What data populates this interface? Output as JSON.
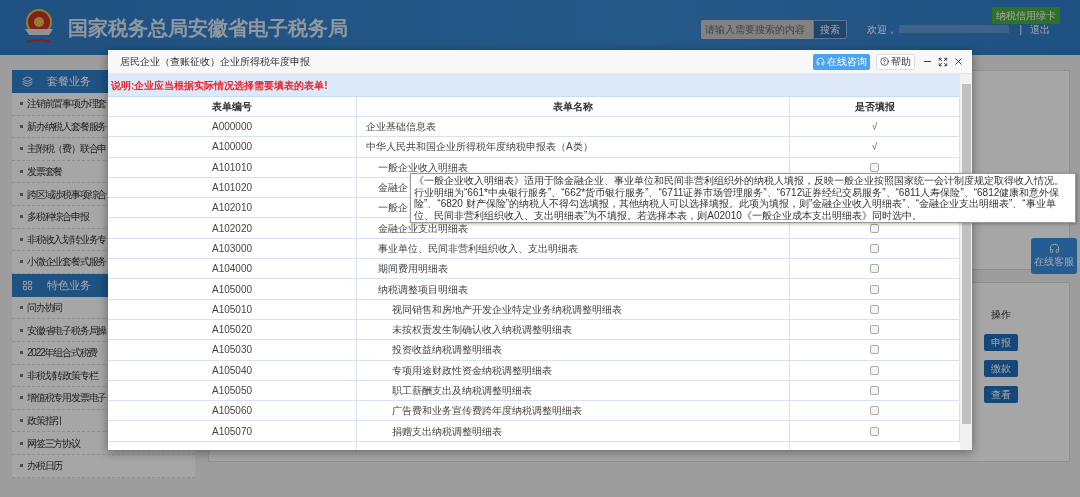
{
  "header": {
    "title": "国家税务总局安徽省电子税务局",
    "search": {
      "placeholder": "请输入需要搜索的内容",
      "button": "搜索"
    },
    "welcome": "欢迎，",
    "separator": "|",
    "logout": "退出",
    "badge": "纳税信用绿卡"
  },
  "sidebar": [
    {
      "title": "套餐业务",
      "items": [
        "注销前置事项办理套",
        "新办纳税人套餐服务",
        "主附税（费）联合申",
        "发票套餐",
        "跨区域涉税事项综合",
        "多税种综合申报",
        "非税收入划转业务专",
        "小微企业套餐式服务"
      ]
    },
    {
      "title": "特色业务",
      "items": [
        "问办协同",
        "安徽省电子税务局操",
        "2022年组合式税费",
        "非税划转政策专栏",
        "增值税专用发票电子",
        "政策指引",
        "网签三方协议",
        "办税日历"
      ]
    }
  ],
  "operations": {
    "column": "操作",
    "buttons": [
      "申报",
      "缴款",
      "查看"
    ]
  },
  "support_button": "在线客服",
  "modal": {
    "title": "居民企业（查账征收）企业所得税年度申报",
    "consult_button": "在线咨询",
    "help_button": "帮助",
    "notice": "说明:企业应当根据实际情况选择需要填表的表单!",
    "columns": [
      "表单编号",
      "表单名称",
      "是否填报"
    ],
    "rows": [
      {
        "code": "A000000",
        "name": "企业基础信息表",
        "fill": {
          "kind": "mark",
          "text": "√"
        }
      },
      {
        "code": "A100000",
        "name": "中华人民共和国企业所得税年度纳税申报表（A类）",
        "fill": {
          "kind": "mark",
          "text": "√"
        },
        "children": [
          {
            "code": "A101010",
            "name": "一般企业收入明细表",
            "fill": {
              "kind": "checkbox",
              "checked": false
            }
          },
          {
            "code": "A101020",
            "name": "金融企"
          },
          {
            "code": "A102010",
            "name": "一般企"
          },
          {
            "code": "A102020",
            "name": "金融企业支出明细表",
            "fill": {
              "kind": "checkbox",
              "checked": false
            }
          },
          {
            "code": "A103000",
            "name": "事业单位、民间非营利组织收入、支出明细表",
            "fill": {
              "kind": "checkbox",
              "checked": false
            }
          },
          {
            "code": "A104000",
            "name": "期间费用明细表",
            "fill": {
              "kind": "checkbox",
              "checked": false
            }
          },
          {
            "code": "A105000",
            "name": "纳税调整项目明细表",
            "fill": {
              "kind": "checkbox",
              "checked": false
            },
            "children": [
              {
                "code": "A105010",
                "name": "视同销售和房地产开发企业特定业务纳税调整明细表",
                "fill": {
                  "kind": "checkbox",
                  "checked": false
                }
              },
              {
                "code": "A105020",
                "name": "未按权责发生制确认收入纳税调整明细表",
                "fill": {
                  "kind": "checkbox",
                  "checked": false
                }
              },
              {
                "code": "A105030",
                "name": "投资收益纳税调整明细表",
                "fill": {
                  "kind": "checkbox",
                  "checked": false
                }
              },
              {
                "code": "A105040",
                "name": "专项用途财政性资金纳税调整明细表",
                "fill": {
                  "kind": "checkbox",
                  "checked": false
                }
              },
              {
                "code": "A105050",
                "name": "职工薪酬支出及纳税调整明细表",
                "fill": {
                  "kind": "checkbox",
                  "checked": false
                }
              },
              {
                "code": "A105060",
                "name": "广告费和业务宣传费跨年度纳税调整明细表",
                "fill": {
                  "kind": "checkbox",
                  "checked": false
                }
              },
              {
                "code": "A105070",
                "name": "捐赠支出纳税调整明细表",
                "fill": {
                  "kind": "checkbox",
                  "checked": false
                }
              }
            ]
          }
        ]
      }
    ],
    "tooltip": "《一般企业收入明细表》适用于除金融企业、事业单位和民间非营利组织外的纳税人填报，反映一般企业按照国家统一会计制度规定取得收入情况。行业明细为“661*中央银行服务”、“662*货币银行服务”、“6711证券市场管理服务”、“6712证券经纪交易服务”、“6811人寿保险”、“6812健康和意外保险”、“6820 财产保险”的纳税人不得勾选填报，其他纳税人可以选择填报。此项为填报，则”金融企业收入明细表”、“金融企业支出明细表”、“事业单位、民间非营利组织收入、支出明细表”为不填报。若选择本表，则A02010《一般企业成本支出明细表》同时选中。"
  }
}
